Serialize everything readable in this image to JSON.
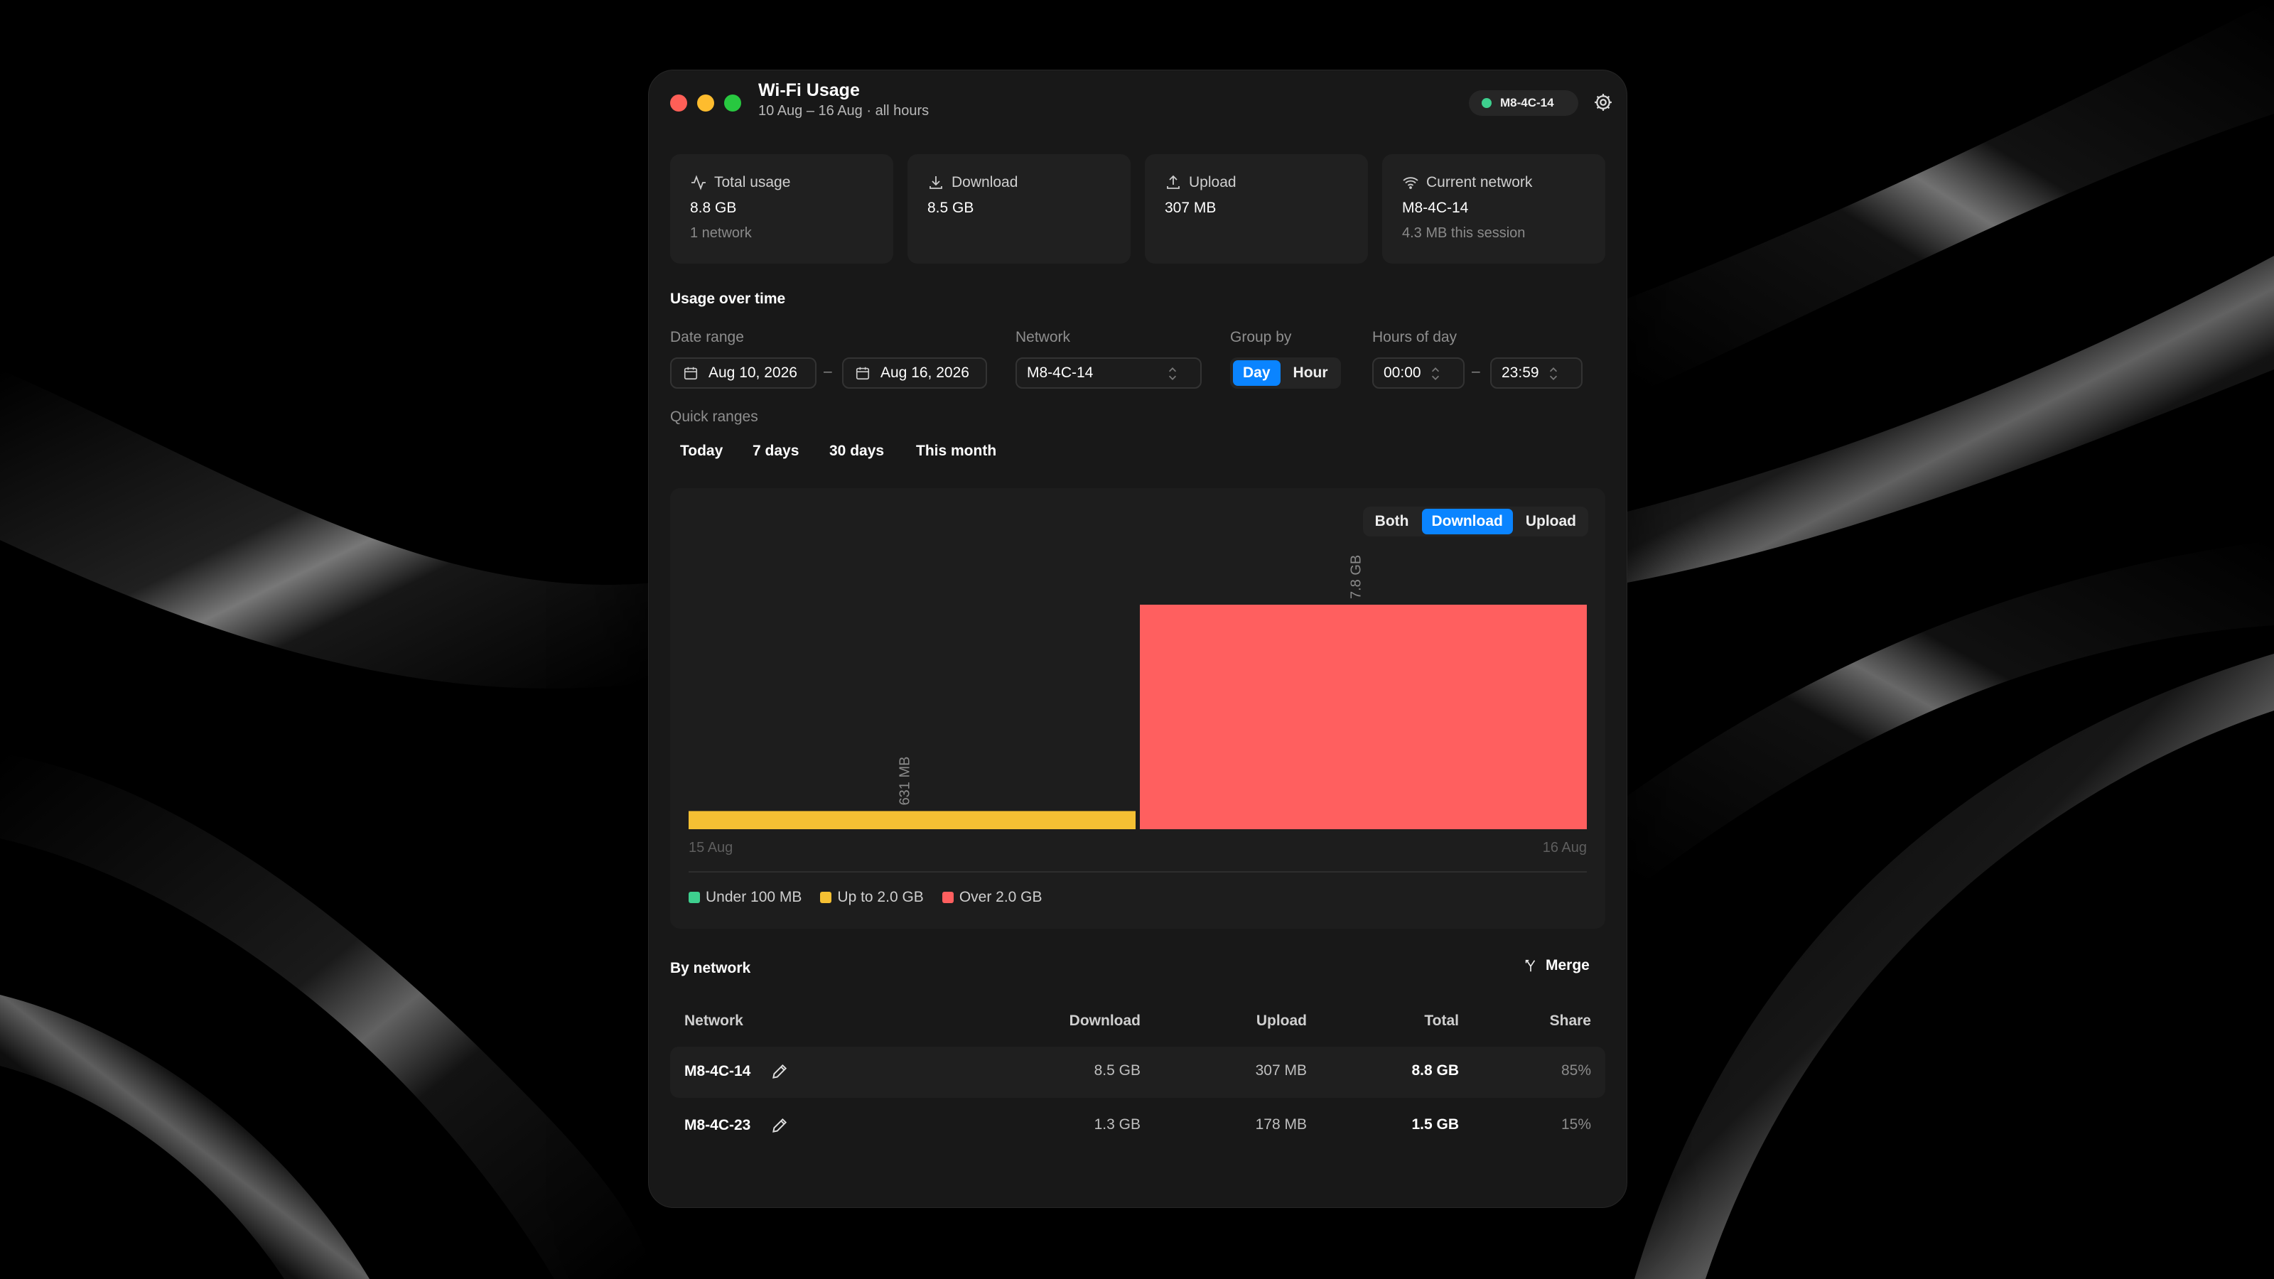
{
  "window": {
    "title": "Wi-Fi Usage",
    "subtitle": "10 Aug – 16 Aug · all hours",
    "network_pill": "M8-4C-14",
    "traffic_lights": {
      "close": "#fe5f57",
      "minimize": "#febc2e",
      "zoom": "#28c840"
    }
  },
  "cards": [
    {
      "label": "Total usage",
      "icon": "activity-icon",
      "value": "8.8 GB",
      "sub": "1 network"
    },
    {
      "label": "Download",
      "icon": "download-icon",
      "value": "8.5 GB",
      "sub": ""
    },
    {
      "label": "Upload",
      "icon": "upload-icon",
      "value": "307 MB",
      "sub": ""
    },
    {
      "label": "Current network",
      "icon": "wifi-icon",
      "value": "M8-4C-14",
      "sub": "4.3 MB this session"
    }
  ],
  "usage": {
    "title": "Usage over time",
    "date_range_label": "Date range",
    "date_start": "Aug 10, 2026",
    "date_end": "Aug 16, 2026",
    "network_label": "Network",
    "network_value": "M8-4C-14",
    "group_by_label": "Group by",
    "group_by_options": [
      "Day",
      "Hour"
    ],
    "group_by_selected": "Day",
    "hours_label": "Hours of day",
    "hours_start": "00:00",
    "hours_end": "23:59",
    "quick_ranges_label": "Quick ranges",
    "quick_ranges": [
      "Today",
      "7 days",
      "30 days",
      "This month"
    ]
  },
  "chart_controls": {
    "options": [
      "Both",
      "Download",
      "Upload"
    ],
    "selected": "Download"
  },
  "chart_data": {
    "type": "bar",
    "categories": [
      "15 Aug",
      "16 Aug"
    ],
    "values": [
      0.631,
      7.8
    ],
    "value_labels": [
      "631 MB",
      "7.8 GB"
    ],
    "colors": [
      "#f5c033",
      "#ff5f5f"
    ],
    "ylim": [
      0,
      7.8
    ],
    "legend": [
      {
        "label": "Under 100 MB",
        "color": "#3ecf8e"
      },
      {
        "label": "Up to 2.0 GB",
        "color": "#f5c033"
      },
      {
        "label": "Over 2.0 GB",
        "color": "#ff5f5f"
      }
    ],
    "legend_position": "bottom-left"
  },
  "by_network": {
    "title": "By network",
    "merge_label": "Merge",
    "columns": [
      "Network",
      "Download",
      "Upload",
      "Total",
      "Share"
    ],
    "rows": [
      {
        "network": "M8-4C-14",
        "download": "8.5 GB",
        "upload": "307 MB",
        "total": "8.8 GB",
        "share": "85%"
      },
      {
        "network": "M8-4C-23",
        "download": "1.3 GB",
        "upload": "178 MB",
        "total": "1.5 GB",
        "share": "15%"
      }
    ]
  }
}
